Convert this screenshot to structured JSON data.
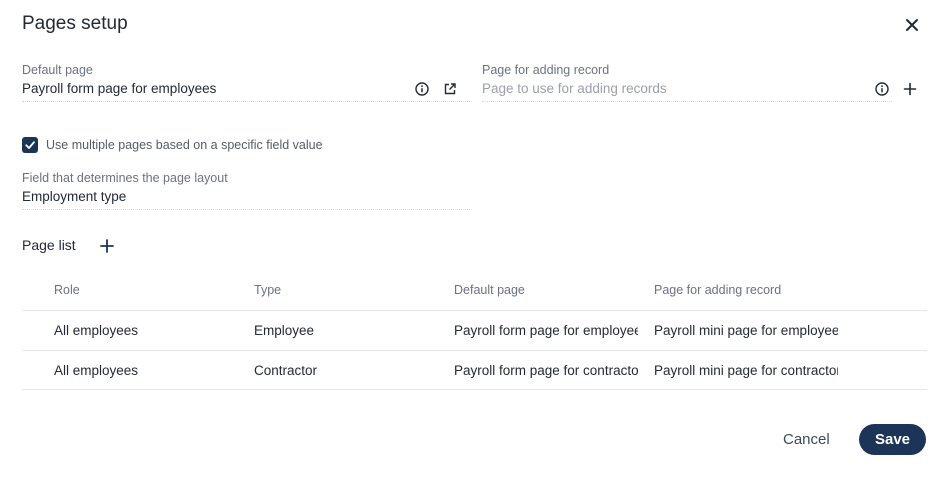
{
  "dialog": {
    "title": "Pages setup",
    "close_icon": "close-icon"
  },
  "default_page": {
    "label": "Default page",
    "value": "Payroll form page for employees",
    "icons": [
      "info-icon",
      "open-external-icon"
    ]
  },
  "adding_page": {
    "label": "Page for adding record",
    "placeholder": "Page to use for adding records",
    "icons": [
      "info-icon",
      "plus-icon"
    ]
  },
  "multiple_pages": {
    "checked": true,
    "label": "Use multiple pages based on a specific field value"
  },
  "layout_field": {
    "label": "Field that determines the page layout",
    "value": "Employment type"
  },
  "page_list": {
    "title": "Page list",
    "add_icon": "plus-icon",
    "columns": [
      "Role",
      "Type",
      "Default page",
      "Page for adding record"
    ],
    "rows": [
      [
        "All employees",
        "Employee",
        "Payroll form page for employees",
        "Payroll mini page for employees"
      ],
      [
        "All employees",
        "Contractor",
        "Payroll form page for contractors",
        "Payroll mini page for contractors"
      ]
    ]
  },
  "footer": {
    "cancel_label": "Cancel",
    "save_label": "Save"
  },
  "colors": {
    "primary": "#1c3557",
    "text": "#222a35",
    "muted": "#6b7280"
  }
}
